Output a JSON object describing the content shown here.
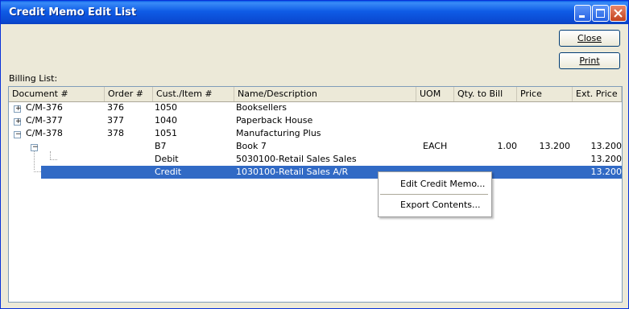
{
  "window": {
    "title": "Credit Memo Edit List"
  },
  "buttons": {
    "close": "Close",
    "print": "Print"
  },
  "caption": "Billing List:",
  "columns": [
    "Document #",
    "Order #",
    "Cust./Item #",
    "Name/Description",
    "UOM",
    "Qty. to Bill",
    "Price",
    "Ext. Price"
  ],
  "rows": [
    {
      "doc": "C/M-376",
      "order": "376",
      "cust": "1050",
      "name": "Booksellers",
      "uom": "",
      "qty": "",
      "price": "",
      "ext": ""
    },
    {
      "doc": "C/M-377",
      "order": "377",
      "cust": "1040",
      "name": "Paperback House",
      "uom": "",
      "qty": "",
      "price": "",
      "ext": ""
    },
    {
      "doc": "C/M-378",
      "order": "378",
      "cust": "1051",
      "name": "Manufacturing Plus",
      "uom": "",
      "qty": "",
      "price": "",
      "ext": ""
    },
    {
      "doc": "",
      "order": "",
      "cust": "B7",
      "name": "Book 7",
      "uom": "EACH",
      "qty": "1.00",
      "price": "13.200",
      "ext": "13.200"
    },
    {
      "doc": "",
      "order": "",
      "cust": "Debit",
      "name": "5030100-Retail Sales Sales",
      "uom": "",
      "qty": "",
      "price": "",
      "ext": "13.200"
    },
    {
      "doc": "",
      "order": "",
      "cust": "Credit",
      "name": "1030100-Retail Sales A/R",
      "uom": "",
      "qty": "",
      "price": "",
      "ext": "13.200"
    }
  ],
  "context_menu": {
    "items": [
      "Edit Credit Memo...",
      "Export Contents..."
    ]
  },
  "colors": {
    "selection": "#316ac5",
    "titlebar": "#0a5be8"
  },
  "icons": {
    "expand": "plus-box-icon",
    "collapse": "minus-box-icon"
  }
}
